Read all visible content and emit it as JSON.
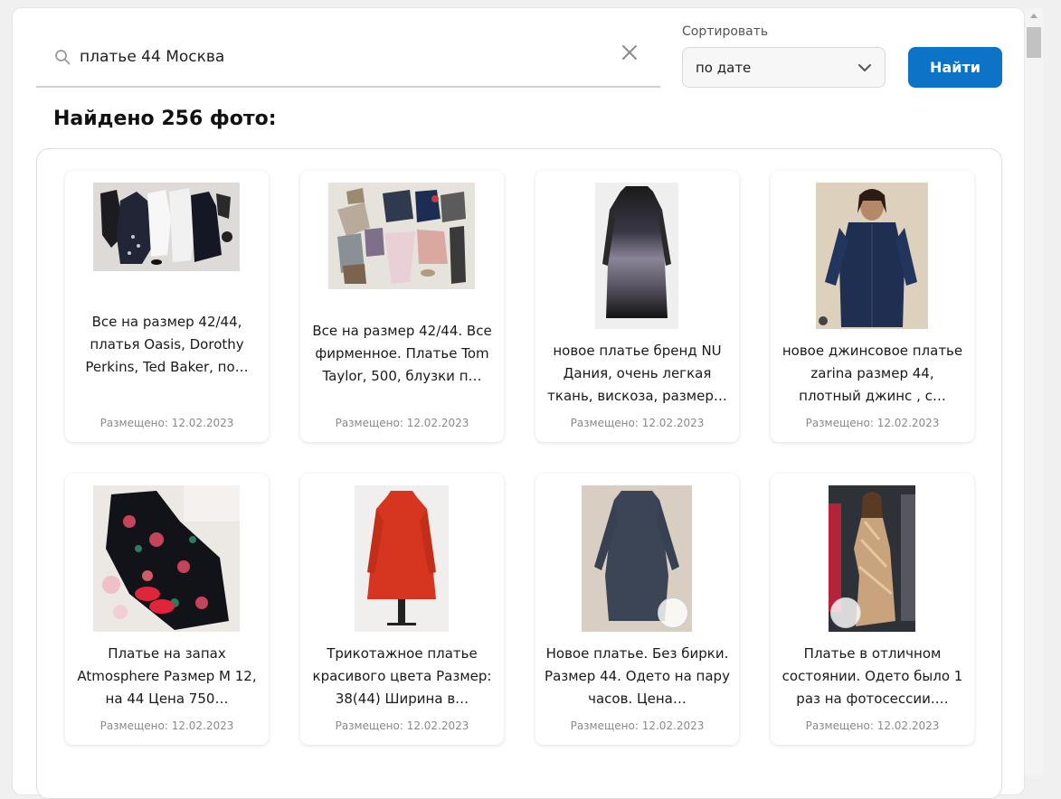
{
  "search": {
    "value": "платье 44 Москва",
    "icon": "search-icon",
    "clear_icon": "close-icon"
  },
  "sort": {
    "label": "Сортировать",
    "value": "по дате"
  },
  "find_button": "Найти",
  "results_title": "Найдено 256 фото:",
  "colors": {
    "accent": "#0d73c7",
    "page_bg": "#f0f0f1",
    "card_bg": "#ffffff"
  },
  "cards": [
    {
      "text": "Все на размер 42/44, платья Oasis, Dorothy Perkins, Ted Baker, по…",
      "date": "Размещено: 12.02.2023"
    },
    {
      "text": "Все на размер 42/44. Все фирменное. Платье Tom Taylor, 500, блузки п…",
      "date": "Размещено: 12.02.2023"
    },
    {
      "text": "новое платье бренд NU Дания, очень легкая ткань, вискоза, размер…",
      "date": "Размещено: 12.02.2023"
    },
    {
      "text": "новое джинсовое платье zarina размер 44, плотный джинс , с…",
      "date": "Размещено: 12.02.2023"
    },
    {
      "text": "Платье на запах Atmosphere Размер M 12, на 44 Цена 750…",
      "date": "Размещено: 12.02.2023"
    },
    {
      "text": "Трикотажное платье красивого цвета Размер: 38(44) Ширина в…",
      "date": "Размещено: 12.02.2023"
    },
    {
      "text": "Новое платье. Без бирки. Размер 44. Одето на пару часов. Цена…",
      "date": "Размещено: 12.02.2023"
    },
    {
      "text": "Платье в отличном состоянии. Одето было 1 раз на фотосессии.…",
      "date": "Размещено: 12.02.2023"
    }
  ]
}
